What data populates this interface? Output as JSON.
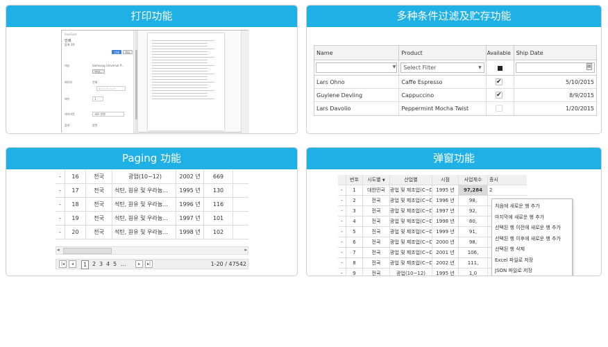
{
  "cards": {
    "print": {
      "title": "打印功能",
      "dialog": {
        "brand": "RealGrid",
        "title": "인쇄",
        "pages_label": "합계 3쪽",
        "print_btn": "인쇄",
        "cancel_btn": "취소",
        "dest_label": "대상",
        "printer": "Samsung Universal P...",
        "change_btn": "변경...",
        "pages_row": "페이지",
        "pages_opt": "전체",
        "pages_sample": "예: 1-5, 8, 11-13",
        "copies_label": "매수",
        "copies_val": "1",
        "layout_label": "레이아웃",
        "layout_val": "세로 방향",
        "color_label": "색상",
        "color_val": "컬러",
        "paper_label": "옵션",
        "opt_val": "양면"
      }
    },
    "filter": {
      "title": "多种条件过滤及贮存功能",
      "headers": [
        "Name",
        "Product",
        "Available",
        "Ship Date"
      ],
      "select_placeholder": "Select Filter",
      "rows": [
        {
          "name": "Lars Ohno",
          "product": "Caffe Espresso",
          "available": true,
          "ship": "5/10/2015"
        },
        {
          "name": "Guylene Devling",
          "product": "Cappuccino",
          "available": true,
          "ship": "8/9/2015"
        },
        {
          "name": "Lars Davolio",
          "product": "Peppermint Mocha Twist",
          "available": false,
          "ship": "1/20/2015"
        }
      ]
    },
    "paging": {
      "title": "Paging 功能",
      "rows": [
        {
          "dash": "-",
          "no": "16",
          "region": "전국",
          "industry": "광업(10~12)",
          "year": "2002 년",
          "count": "669"
        },
        {
          "dash": "-",
          "no": "17",
          "region": "전국",
          "industry": "석탄, 원유 및 우라늄...",
          "year": "1995 년",
          "count": "130"
        },
        {
          "dash": "-",
          "no": "18",
          "region": "전국",
          "industry": "석탄, 원유 및 우라늄...",
          "year": "1996 년",
          "count": "116"
        },
        {
          "dash": "-",
          "no": "19",
          "region": "전국",
          "industry": "석탄, 원유 및 우라늄...",
          "year": "1997 년",
          "count": "101"
        },
        {
          "dash": "-",
          "no": "20",
          "region": "전국",
          "industry": "석탄, 원유 및 우라늄...",
          "year": "1998 년",
          "count": "102"
        }
      ],
      "pages": [
        "1",
        "2",
        "3",
        "4",
        "5",
        "..."
      ],
      "range": "1-20 / 47542"
    },
    "popup": {
      "title": "弹窗功能",
      "headers": [
        "",
        "번호",
        "시도별",
        "산업별",
        "시점",
        "사업체수",
        "종사"
      ],
      "rows": [
        {
          "dash": "-",
          "no": "1",
          "region": "대한민국",
          "industry": "광업 및 제조업(C~D)",
          "year": "1995 년",
          "count": "97,284",
          "extra": "2"
        },
        {
          "dash": "-",
          "no": "2",
          "region": "전국",
          "industry": "광업 및 제조업(C~D)",
          "year": "1996 년",
          "count": "98,",
          "extra": ""
        },
        {
          "dash": "-",
          "no": "3",
          "region": "전국",
          "industry": "광업 및 제조업(C~D)",
          "year": "1997 년",
          "count": "92,",
          "extra": ""
        },
        {
          "dash": "-",
          "no": "4",
          "region": "전국",
          "industry": "광업 및 제조업(C~D)",
          "year": "1998 년",
          "count": "80,",
          "extra": ""
        },
        {
          "dash": "-",
          "no": "5",
          "region": "전국",
          "industry": "광업 및 제조업(C~D)",
          "year": "1999 년",
          "count": "91,",
          "extra": ""
        },
        {
          "dash": "-",
          "no": "6",
          "region": "전국",
          "industry": "광업 및 제조업(C~D)",
          "year": "2000 년",
          "count": "98,",
          "extra": ""
        },
        {
          "dash": "-",
          "no": "7",
          "region": "전국",
          "industry": "광업 및 제조업(C~D)",
          "year": "2001 년",
          "count": "106,",
          "extra": ""
        },
        {
          "dash": "-",
          "no": "8",
          "region": "전국",
          "industry": "광업 및 제조업(C~D)",
          "year": "2002 년",
          "count": "111,",
          "extra": ""
        },
        {
          "dash": "-",
          "no": "9",
          "region": "전국",
          "industry": "광업(10~12)",
          "year": "1995 년",
          "count": "1,0",
          "extra": ""
        }
      ],
      "menu": [
        "처음에 새로운 행 추가",
        "마지막에 새로운 행 추가",
        "선택된 행 이전에 새로운 행 추가",
        "선택된 행 이후에 새로운 행 추가",
        "선택된 행 삭제",
        "Excel 파일로 저장",
        "JSON 파일로 저장"
      ]
    }
  },
  "colors": {
    "header_bg": "#1fb0e6",
    "border": "#cfcfcf"
  }
}
